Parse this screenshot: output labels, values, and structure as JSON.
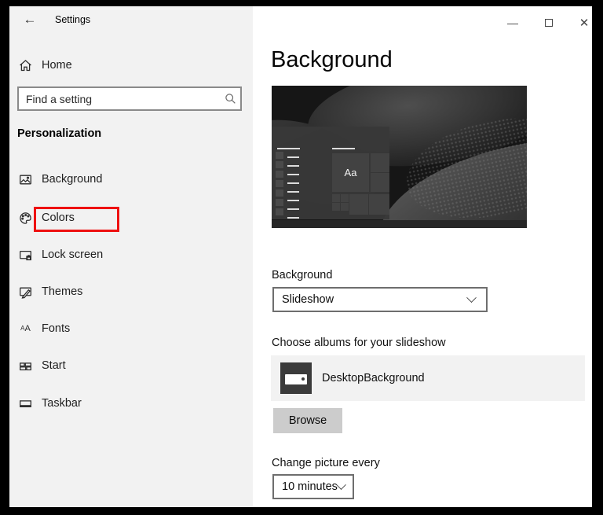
{
  "titlebar": {
    "title": "Settings",
    "back_glyph": "←",
    "minimize_glyph": "—",
    "close_glyph": "✕"
  },
  "sidebar": {
    "home_label": "Home",
    "search_placeholder": "Find a setting",
    "section_title": "Personalization",
    "items": [
      {
        "label": "Background",
        "icon": "image-icon",
        "highlighted": false
      },
      {
        "label": "Colors",
        "icon": "palette-icon",
        "highlighted": true
      },
      {
        "label": "Lock screen",
        "icon": "lock-screen-icon",
        "highlighted": false
      },
      {
        "label": "Themes",
        "icon": "themes-icon",
        "highlighted": false
      },
      {
        "label": "Fonts",
        "icon": "fonts-icon",
        "highlighted": false
      },
      {
        "label": "Start",
        "icon": "start-icon",
        "highlighted": false
      },
      {
        "label": "Taskbar",
        "icon": "taskbar-icon",
        "highlighted": false
      }
    ]
  },
  "main": {
    "page_title": "Background",
    "preview_tile_label": "Aa",
    "background_label": "Background",
    "background_value": "Slideshow",
    "albums_label": "Choose albums for your slideshow",
    "album_name": "DesktopBackground",
    "browse_label": "Browse",
    "change_label": "Change picture every",
    "change_value": "10 minutes"
  },
  "colors": {
    "frame": "#000000",
    "sidebar_bg": "#f2f2f2",
    "main_bg": "#ffffff",
    "highlight_red": "#ee1111",
    "browse_button_bg": "#cccccc",
    "album_row_bg": "#f2f2f2",
    "preview_bg": "#161616"
  }
}
